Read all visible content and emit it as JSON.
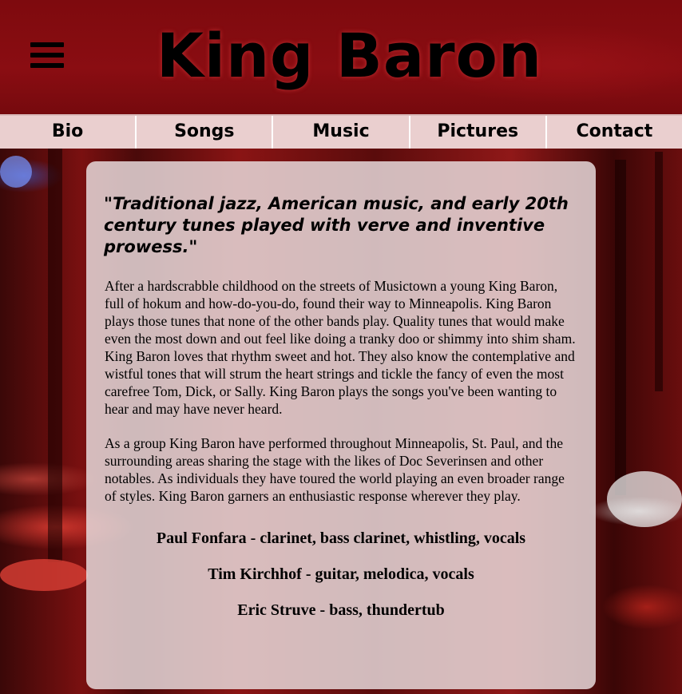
{
  "header": {
    "title": "King Baron",
    "menu_icon": "hamburger-menu-icon"
  },
  "nav": {
    "items": [
      {
        "label": "Bio"
      },
      {
        "label": "Songs"
      },
      {
        "label": "Music"
      },
      {
        "label": "Pictures"
      },
      {
        "label": "Contact"
      }
    ]
  },
  "content": {
    "quote": "\"Traditional jazz, American music, and early 20th century tunes played with verve and inventive prowess.\"",
    "paragraphs": [
      "After a hardscrabble childhood on the streets of Musictown a young King Baron, full of hokum and how-do-you-do, found their way to Minneapolis. King Baron plays those tunes that none of the other bands play. Quality tunes that would make even the most down and out feel like doing a tranky doo or shimmy into shim sham. King Baron loves that rhythm sweet and hot. They also know the contemplative and wistful tones that will strum the heart strings and tickle the fancy of even the most carefree Tom, Dick, or Sally. King Baron plays the songs you've been wanting to hear and may have never heard.",
      "As a group King Baron have performed throughout Minneapolis, St. Paul, and the surrounding areas sharing the stage with the likes of Doc Severinsen and other notables. As individuals they have toured the world playing an even broader range of styles. King Baron garners an enthusiastic response wherever they play."
    ],
    "members": [
      "Paul Fonfara - clarinet, bass clarinet, whistling, vocals",
      "Tim Kirchhof - guitar, melodica, vocals",
      "Eric Struve - bass, thundertub"
    ]
  },
  "colors": {
    "header_bg": "#830c10",
    "nav_bg": "#eacfcf",
    "card_bg": "#e8dcde"
  }
}
